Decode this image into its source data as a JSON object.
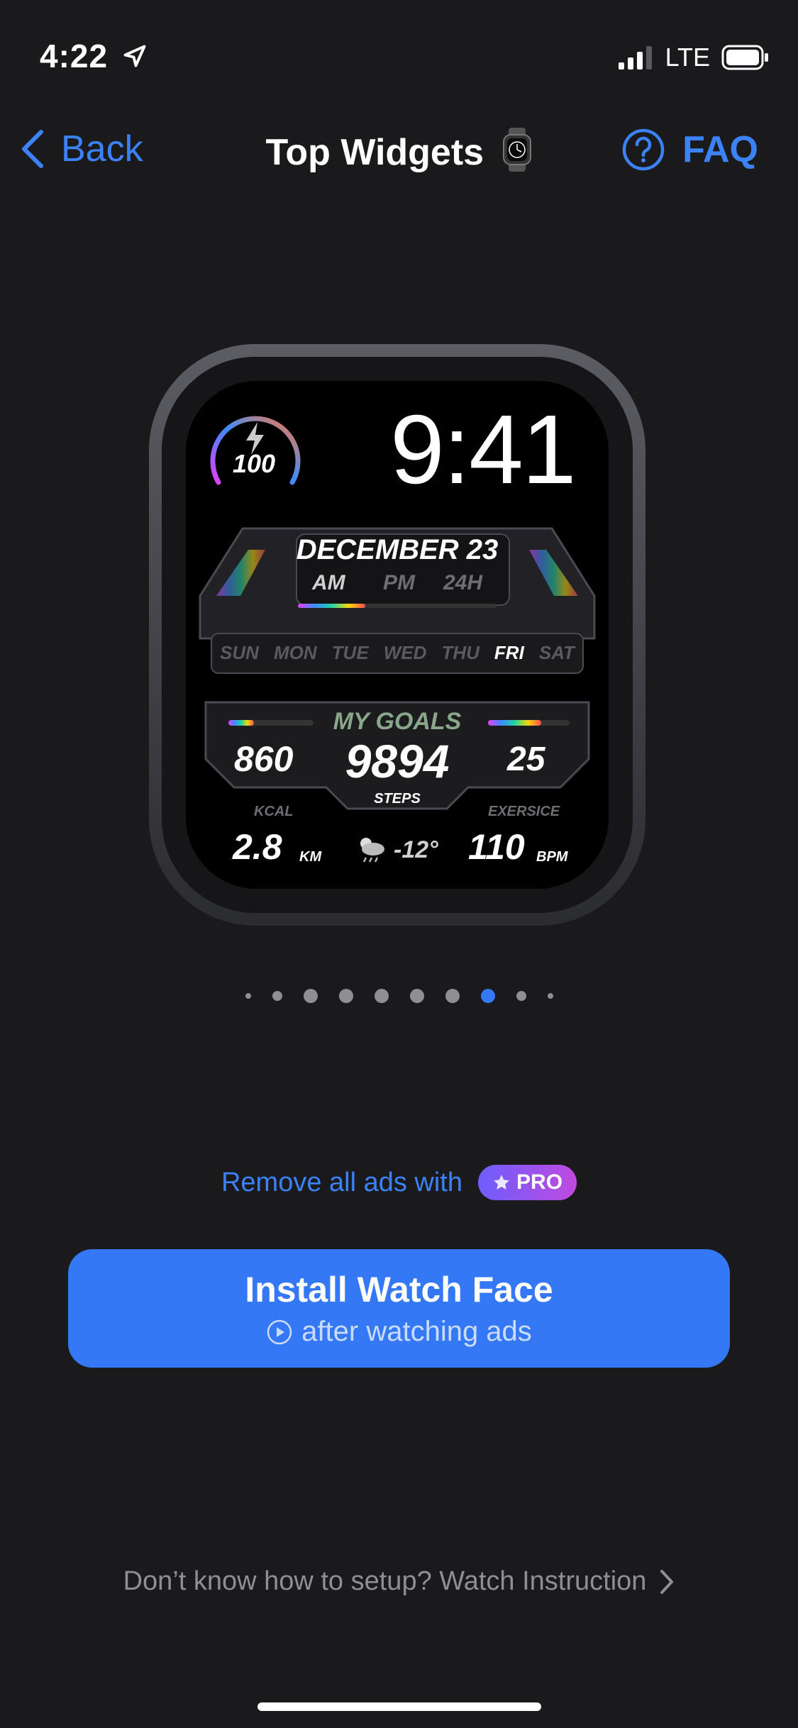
{
  "status_bar": {
    "time": "4:22",
    "network": "LTE"
  },
  "nav": {
    "back_label": "Back",
    "title": "Top Widgets",
    "faq_label": "FAQ"
  },
  "watch_face": {
    "battery": "100",
    "time": "9:41",
    "date": "DECEMBER 23",
    "am": "AM",
    "pm": "PM",
    "h24": "24H",
    "days": [
      "SUN",
      "MON",
      "TUE",
      "WED",
      "THU",
      "FRI",
      "SAT"
    ],
    "active_day": "FRI",
    "goals_title": "MY GOALS",
    "kcal_value": "860",
    "kcal_label": "KCAL",
    "steps_value": "9894",
    "steps_label": "STEPS",
    "exercise_value": "25",
    "exercise_label": "EXERSICE",
    "distance_value": "2.8",
    "distance_unit": "KM",
    "temp": "-12°",
    "bpm_value": "110",
    "bpm_unit": "BPM"
  },
  "pagination": {
    "total": 10,
    "active_index": 7
  },
  "promo": {
    "text": "Remove all ads with",
    "badge": "PRO"
  },
  "install_button": {
    "title": "Install Watch Face",
    "subtitle": "after watching ads"
  },
  "instruction_link": "Don’t know how to setup? Watch Instruction",
  "colors": {
    "accent": "#3478f6",
    "background": "#1a1a1c"
  }
}
